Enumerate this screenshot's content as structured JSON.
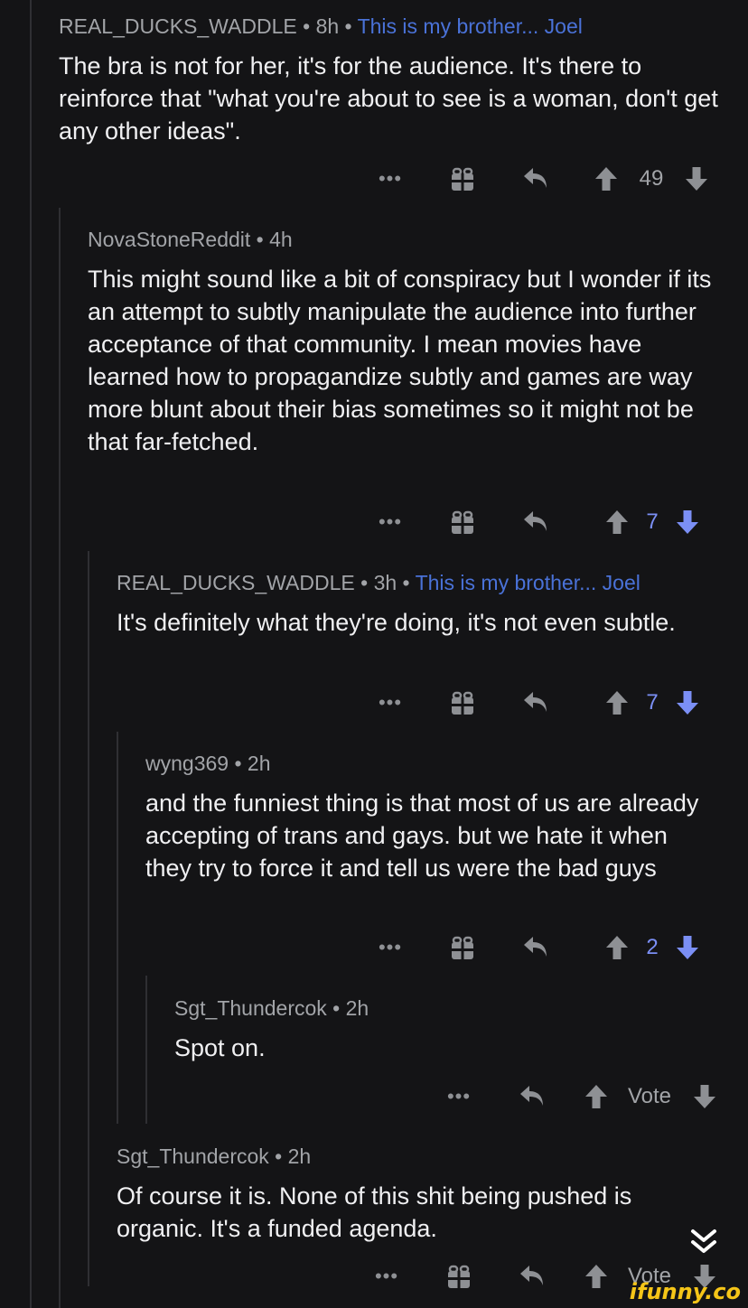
{
  "comments": [
    {
      "author": "REAL_DUCKS_WADDLE",
      "sep1": " • ",
      "age": "8h",
      "sep2": " • ",
      "flair": "This is my brother... Joel",
      "text": "The bra is not for her, it's for the audience. It's there to reinforce that \"what you're about to see is a woman, don't get any other ideas\".",
      "score": "49",
      "downvoted": false
    },
    {
      "author": "NovaStoneReddit",
      "sep1": " • ",
      "age": "4h",
      "text": "This might sound like a bit of conspiracy but I wonder if its an attempt to subtly manipulate the audience into further acceptance of that community. I mean movies have learned how to propagandize subtly and games are way more blunt about their bias sometimes so it might not be that far-fetched.",
      "score": "7",
      "downvoted": true
    },
    {
      "author": "REAL_DUCKS_WADDLE",
      "sep1": " • ",
      "age": "3h",
      "sep2": " • ",
      "flair": "This is my brother... Joel",
      "text": "It's definitely what they're doing, it's not even subtle.",
      "score": "7",
      "downvoted": true
    },
    {
      "author": "wyng369",
      "sep1": " • ",
      "age": "2h",
      "text": "and the funniest thing is that most of us are already accepting of trans and gays. but we hate it when they try to force it and tell us were the bad guys",
      "score": "2",
      "downvoted": true
    },
    {
      "author": "Sgt_Thundercok",
      "sep1": " • ",
      "age": "2h",
      "text": "Spot on.",
      "score": "Vote",
      "downvoted": false
    },
    {
      "author": "Sgt_Thundercok",
      "sep1": " • ",
      "age": "2h",
      "text": "Of course it is.  None of this shit being pushed is organic. It's a funded agenda.",
      "score": "Vote",
      "downvoted": false
    }
  ],
  "actions": {
    "more": "•••"
  },
  "icons": {
    "more": "more-dots-icon",
    "award": "gift-award-icon",
    "reply": "reply-arrow-icon",
    "upvote": "upvote-arrow-icon",
    "downvote": "downvote-arrow-icon",
    "scroll": "double-chevron-down-icon"
  },
  "colors": {
    "background": "#141416",
    "flair": "#4a72d8",
    "downvote_active": "#7b8ff5",
    "text": "#f0f0f2",
    "meta": "#a2a4a8"
  },
  "watermark": "ifunny.co"
}
